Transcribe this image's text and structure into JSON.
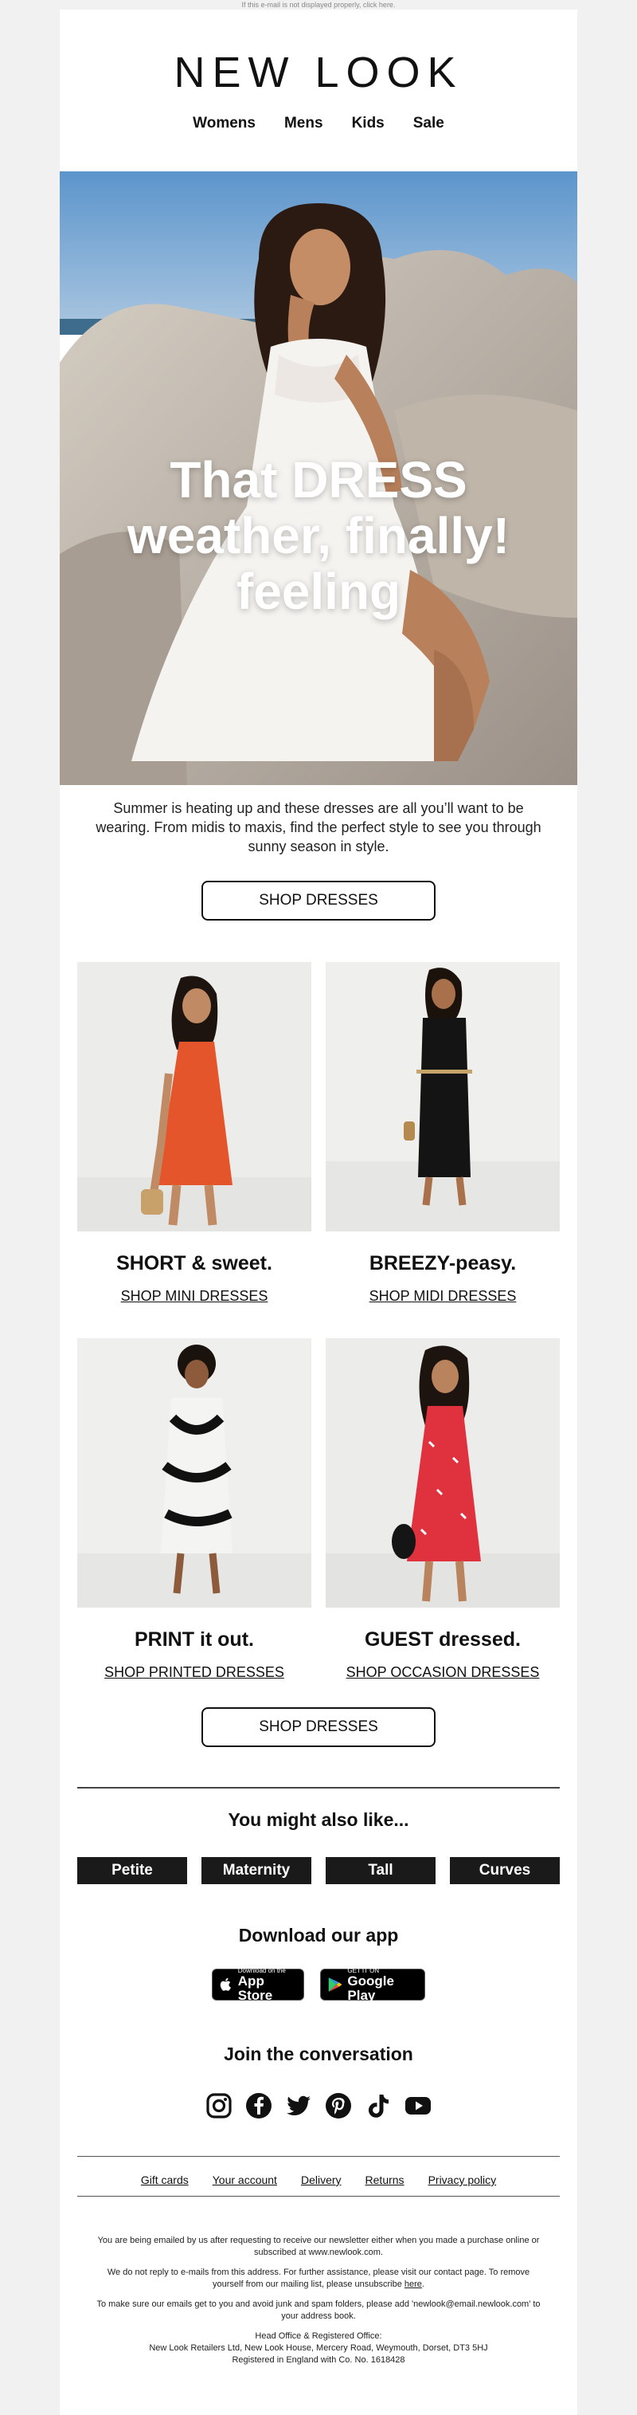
{
  "preheader": "If this e-mail is not displayed properly, click here.",
  "header": {
    "logo": "NEW LOOK",
    "nav": [
      "Womens",
      "Mens",
      "Kids",
      "Sale"
    ]
  },
  "hero": {
    "line1": "That DRESS",
    "line2": "weather, finally!",
    "line3": "feeling"
  },
  "intro": "Summer is heating up and these dresses are all you’ll want to be wearing. From midis to maxis, find the perfect style to see you through sunny season in style.",
  "cta_primary": "SHOP DRESSES",
  "products": [
    {
      "title": "SHORT & sweet.",
      "link": "SHOP MINI DRESSES"
    },
    {
      "title": "BREEZY-peasy.",
      "link": "SHOP MIDI DRESSES"
    },
    {
      "title": "PRINT it out.",
      "link": "SHOP PRINTED DRESSES"
    },
    {
      "title": "GUEST dressed.",
      "link": "SHOP OCCASION DRESSES"
    }
  ],
  "cta_secondary": "SHOP DRESSES",
  "also_like": {
    "title": "You might also like...",
    "items": [
      "Petite",
      "Maternity",
      "Tall",
      "Curves"
    ]
  },
  "app": {
    "title": "Download our app",
    "apple_small": "Download on the",
    "apple_big": "App Store",
    "google_small": "GET IT ON",
    "google_big": "Google Play"
  },
  "conversation": {
    "title": "Join the conversation",
    "icons": [
      "instagram-icon",
      "facebook-icon",
      "twitter-icon",
      "pinterest-icon",
      "tiktok-icon",
      "youtube-icon"
    ]
  },
  "footer": {
    "links": [
      "Gift cards",
      "Your account",
      "Delivery",
      "Returns",
      "Privacy policy"
    ],
    "legal1": "You are being emailed by us after requesting to receive our newsletter either when you made a purchase online or subscribed at www.newlook.com.",
    "legal2_pre": "We do not reply to e-mails from this address. For further assistance, please visit our contact page. To remove yourself from our mailing list, please unsubscribe",
    "legal2_link": "here",
    "legal3": "To make sure our emails get to you and avoid junk and spam folders, please add 'newlook@email.newlook.com' to your address book.",
    "legal4": "Head Office & Registered Office:",
    "legal5": "New Look Retailers Ltd, New Look House, Mercery Road, Weymouth, Dorset, DT3 5HJ",
    "legal6": "Registered in England with Co. No. 1618428"
  },
  "colors": {
    "background": "#f1f1f1",
    "content": "#ffffff",
    "pill": "#1a1a1a",
    "text": "#111111"
  }
}
